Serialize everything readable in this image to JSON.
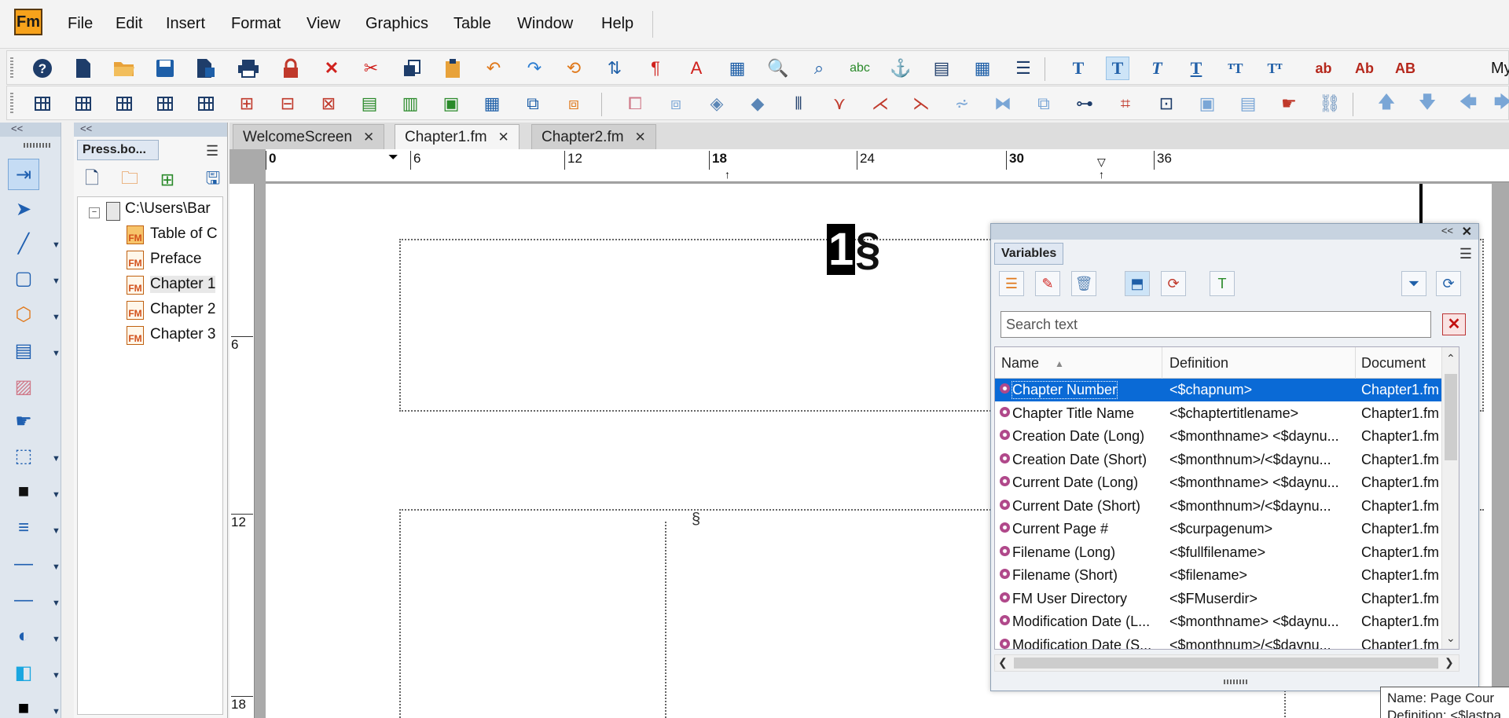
{
  "app": {
    "logo": "Fm"
  },
  "menu": [
    "File",
    "Edit",
    "Insert",
    "Format",
    "View",
    "Graphics",
    "Table",
    "Window",
    "Help"
  ],
  "toolbar1": {
    "text_buttons": [
      "T",
      "T",
      "T",
      "T",
      "ᵀT",
      "Tᵀ",
      "ab",
      "Ab",
      "AB"
    ],
    "overflow_label": "My"
  },
  "tools_panel": {
    "collapse_label": "<<"
  },
  "book_panel": {
    "collapse_label": "<<",
    "tab_label": "Press.bo...",
    "tree": {
      "root": "C:\\Users\\Bar",
      "items": [
        "Table of C",
        "Preface",
        "Chapter 1",
        "Chapter 2",
        "Chapter 3"
      ],
      "file_icon_label": "FM"
    }
  },
  "doc_tabs": [
    "WelcomeScreen",
    "Chapter1.fm",
    "Chapter2.fm"
  ],
  "ruler": {
    "h_ticks": [
      "0",
      "6",
      "12",
      "18",
      "24",
      "30",
      "36"
    ],
    "v_ticks": [
      "6",
      "12",
      "18"
    ]
  },
  "page": {
    "chapter_number": "1",
    "section_symbol": "§",
    "body_section_symbol": "§"
  },
  "variables_pod": {
    "collapse_label": "<<",
    "close_label": "✕",
    "tab_label": "Variables",
    "search_placeholder": "Search text",
    "columns": [
      "Name",
      "Definition",
      "Document"
    ],
    "rows": [
      {
        "name": "Chapter Number",
        "definition": "<$chapnum>",
        "document": "Chapter1.fm"
      },
      {
        "name": "Chapter Title Name",
        "definition": "<$chaptertitlename>",
        "document": "Chapter1.fm"
      },
      {
        "name": "Creation Date (Long)",
        "definition": "<$monthname> <$daynu...",
        "document": "Chapter1.fm"
      },
      {
        "name": "Creation Date (Short)",
        "definition": "<$monthnum>/<$daynu...",
        "document": "Chapter1.fm"
      },
      {
        "name": "Current Date (Long)",
        "definition": "<$monthname> <$daynu...",
        "document": "Chapter1.fm"
      },
      {
        "name": "Current Date (Short)",
        "definition": "<$monthnum>/<$daynu...",
        "document": "Chapter1.fm"
      },
      {
        "name": "Current Page #",
        "definition": "<$curpagenum>",
        "document": "Chapter1.fm"
      },
      {
        "name": "Filename (Long)",
        "definition": "<$fullfilename>",
        "document": "Chapter1.fm"
      },
      {
        "name": "Filename (Short)",
        "definition": "<$filename>",
        "document": "Chapter1.fm"
      },
      {
        "name": "FM User Directory",
        "definition": "<$FMuserdir>",
        "document": "Chapter1.fm"
      },
      {
        "name": "Modification Date (L...",
        "definition": "<$monthname> <$daynu...",
        "document": "Chapter1.fm"
      },
      {
        "name": "Modification Date (S...",
        "definition": "<$monthnum>/<$daynu...",
        "document": "Chapter1.fm"
      }
    ]
  },
  "tooltip": {
    "line1": "Name: Page Cour",
    "line2": "Definition: <$lastpa"
  },
  "colors": {
    "selection": "#0a6ad6",
    "logo": "#f7a21b",
    "accent_blue": "#2160a8"
  }
}
